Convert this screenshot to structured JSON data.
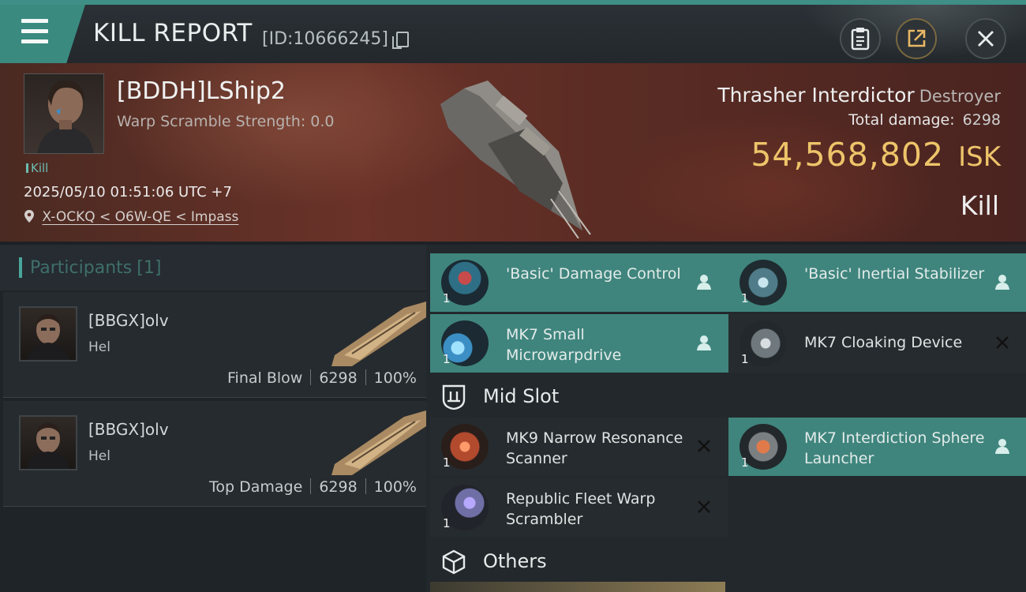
{
  "header": {
    "title": "KILL REPORT",
    "report_id": "[ID:10666245]"
  },
  "victim": {
    "name": "[BDDH]LShip2",
    "warp_scramble": "Warp Scramble Strength: 0.0",
    "tag": "Kill",
    "datetime": "2025/05/10 01:51:06 UTC +7",
    "location": "X-OCKQ < O6W-QE < Impass",
    "ship_name": "Thrasher Interdictor",
    "ship_class": "Destroyer",
    "total_damage_label": "Total damage:",
    "total_damage_value": "6298",
    "isk_value": "54,568,802",
    "isk_unit": "ISK",
    "result": "Kill"
  },
  "participants": {
    "label": "Participants",
    "count": "[1]",
    "rows": [
      {
        "name": "[BBGX]olv",
        "corp": "Hel",
        "role": "Final Blow",
        "damage": "6298",
        "pct": "100%"
      },
      {
        "name": "[BBGX]olv",
        "corp": "Hel",
        "role": "Top Damage",
        "damage": "6298",
        "pct": "100%"
      }
    ]
  },
  "modules": {
    "low": [
      {
        "name": "'Basic' Damage Control",
        "qty": "1",
        "status": "fitted"
      },
      {
        "name": "'Basic' Inertial Stabilizer",
        "qty": "1",
        "status": "fitted"
      },
      {
        "name": "MK7 Small Microwarpdrive",
        "qty": "1",
        "status": "fitted"
      },
      {
        "name": "MK7 Cloaking Device",
        "qty": "1",
        "status": "destroyed"
      }
    ],
    "mid_label": "Mid Slot",
    "mid": [
      {
        "name": "MK9 Narrow Resonance Scanner",
        "qty": "1",
        "status": "destroyed"
      },
      {
        "name": "MK7 Interdiction Sphere Launcher",
        "qty": "1",
        "status": "fitted"
      },
      {
        "name": "Republic Fleet Warp Scrambler",
        "qty": "1",
        "status": "destroyed"
      }
    ],
    "others_label": "Others"
  },
  "colors": {
    "accent_teal": "#3f857d",
    "isk_gold": "#eec46a"
  }
}
